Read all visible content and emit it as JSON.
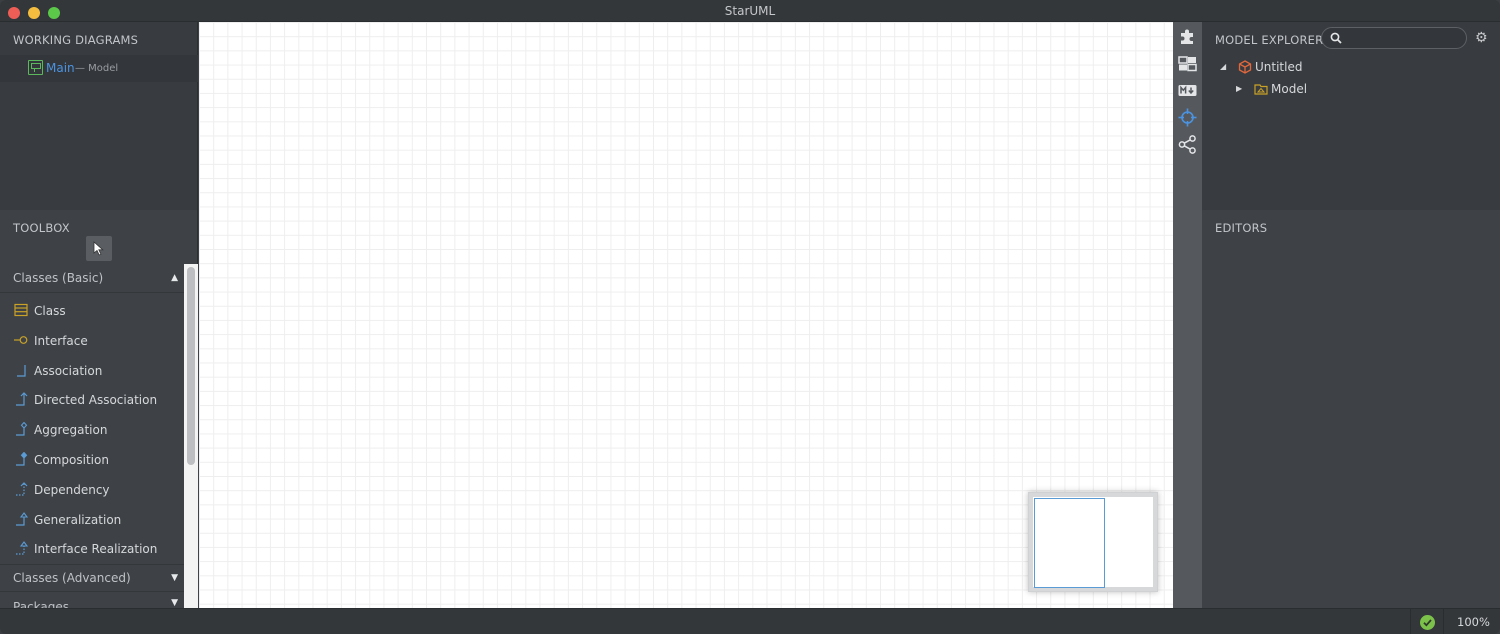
{
  "window": {
    "title": "StarUML"
  },
  "working_diagrams": {
    "title": "WORKING DIAGRAMS",
    "items": [
      {
        "name": "Main",
        "owner": "— Model"
      }
    ]
  },
  "toolbox": {
    "title": "TOOLBOX",
    "groups": [
      {
        "label": "Classes (Basic)",
        "expanded": true
      },
      {
        "label": "Classes (Advanced)",
        "expanded": false
      },
      {
        "label": "Packages",
        "expanded": false
      }
    ],
    "tools": [
      {
        "label": "Class",
        "icon": "class-icon"
      },
      {
        "label": "Interface",
        "icon": "interface-icon"
      },
      {
        "label": "Association",
        "icon": "association-icon"
      },
      {
        "label": "Directed Association",
        "icon": "directed-association-icon"
      },
      {
        "label": "Aggregation",
        "icon": "aggregation-icon"
      },
      {
        "label": "Composition",
        "icon": "composition-icon"
      },
      {
        "label": "Dependency",
        "icon": "dependency-icon"
      },
      {
        "label": "Generalization",
        "icon": "generalization-icon"
      },
      {
        "label": "Interface Realization",
        "icon": "interface-realization-icon"
      }
    ]
  },
  "model_explorer": {
    "title": "MODEL EXPLORER",
    "search_placeholder": "",
    "tree": [
      {
        "label": "Untitled",
        "icon": "project-icon",
        "expanded": true
      },
      {
        "label": "Model",
        "icon": "model-package-icon",
        "expanded": false
      }
    ]
  },
  "editors": {
    "title": "EDITORS"
  },
  "status": {
    "zoom": "100%"
  },
  "colors": {
    "accent": "#4b93e0",
    "ok": "#7cc24a",
    "toolbox_icon": "#c9a227",
    "line_icon": "#5b9bd5"
  }
}
